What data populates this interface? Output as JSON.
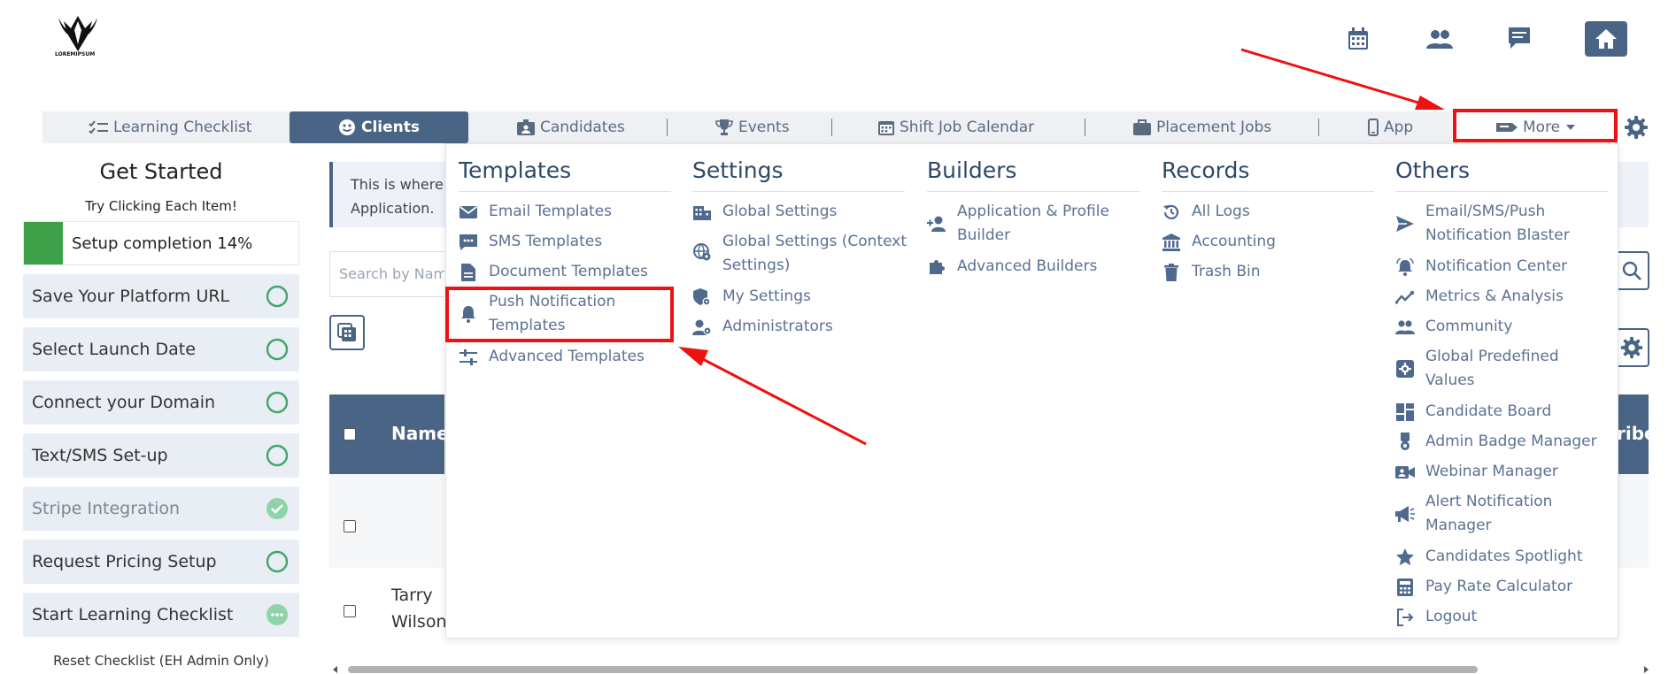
{
  "logo": {
    "text": "LOREMIPSUM"
  },
  "nav": {
    "learning_checklist": "Learning Checklist",
    "clients": "Clients",
    "candidates": "Candidates",
    "events": "Events",
    "shift_job_calendar": "Shift Job Calendar",
    "placement_jobs": "Placement Jobs",
    "app": "App",
    "more": "More"
  },
  "sidebar": {
    "title": "Get Started",
    "subtitle": "Try Clicking Each Item!",
    "setup_completion_label": "Setup completion 14%",
    "setup_completion_value": 14,
    "items": [
      {
        "label": "Save Your Platform URL",
        "status": "incomplete"
      },
      {
        "label": "Select Launch Date",
        "status": "incomplete"
      },
      {
        "label": "Connect your Domain",
        "status": "incomplete"
      },
      {
        "label": "Text/SMS Set-up",
        "status": "incomplete"
      },
      {
        "label": "Stripe Integration",
        "status": "complete"
      },
      {
        "label": "Request Pricing Setup",
        "status": "incomplete"
      },
      {
        "label": "Start Learning Checklist",
        "status": "in-progress"
      }
    ],
    "reset_label": "Reset Checklist (EH Admin Only)"
  },
  "main": {
    "info_line1": "This is where",
    "info_line2": "Application.",
    "search_placeholder": "Search by Nam",
    "table": {
      "header_name": "Name",
      "header_right_partial": "ribed",
      "row2_name_line1": "Tarry",
      "row2_name_line2": "Wilson"
    }
  },
  "menu": {
    "templates": {
      "heading": "Templates",
      "items": [
        "Email Templates",
        "SMS Templates",
        "Document Templates",
        "Push Notification",
        "Templates",
        "Advanced Templates"
      ]
    },
    "settings": {
      "heading": "Settings",
      "items": [
        "Global Settings",
        "Global Settings (Context",
        "Settings)",
        "My Settings",
        "Administrators"
      ]
    },
    "builders": {
      "heading": "Builders",
      "items": [
        "Application & Profile",
        "Builder",
        "Advanced Builders"
      ]
    },
    "records": {
      "heading": "Records",
      "items": [
        "All Logs",
        "Accounting",
        "Trash Bin"
      ]
    },
    "others": {
      "heading": "Others",
      "items": [
        "Email/SMS/Push",
        "Notification Blaster",
        "Notification Center",
        "Metrics & Analysis",
        "Community",
        "Global Predefined",
        "Values",
        "Candidate Board",
        "Admin Badge Manager",
        "Webinar Manager",
        "Alert Notification",
        "Manager",
        "Candidates Spotlight",
        "Pay Rate Calculator",
        "Logout"
      ]
    }
  },
  "colors": {
    "primary": "#4a6485",
    "menu_text": "#5b7291",
    "heading": "#2f4868",
    "highlight": "#ee1111",
    "success": "#3fa04a"
  }
}
